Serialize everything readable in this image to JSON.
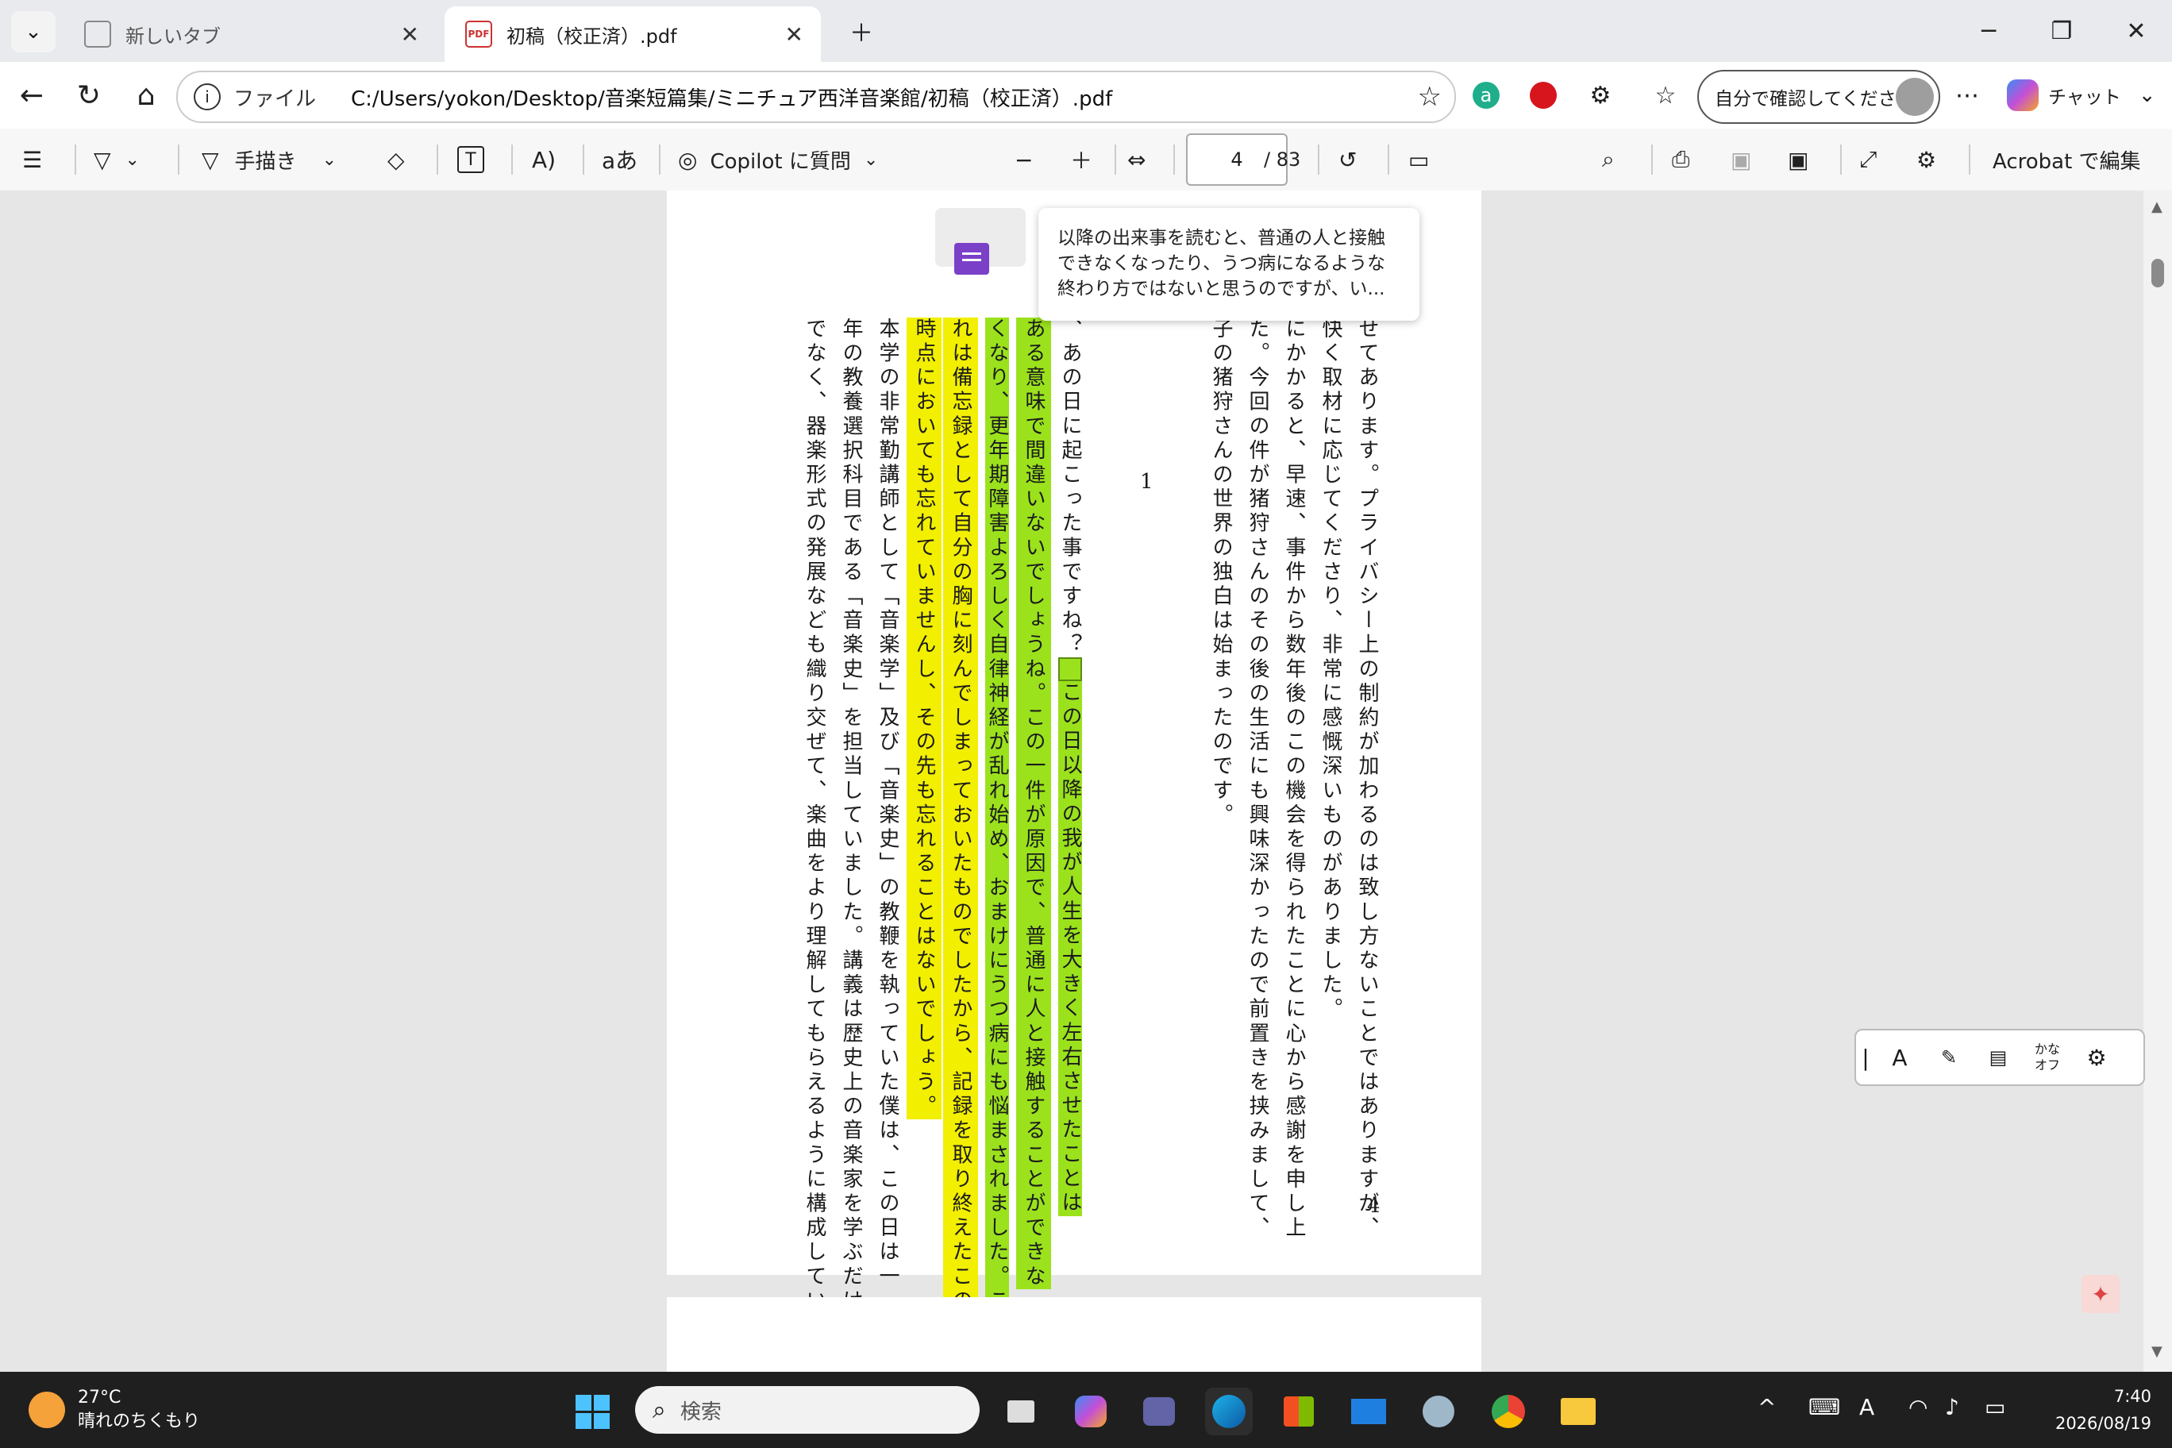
{
  "tabs": [
    {
      "label": "新しいタブ"
    },
    {
      "label": "初稿（校正済）.pdf"
    }
  ],
  "window": {
    "minimize": "─",
    "maximize": "❐",
    "close": "✕"
  },
  "address": {
    "scheme_label": "ファイル",
    "url": "C:/Users/yokon/Desktop/音楽短篇集/ミニチュア西洋音楽館/初稿（校正済）.pdf"
  },
  "profile": {
    "label": "自分で確認してください"
  },
  "chat": {
    "label": "チャット"
  },
  "toolbar": {
    "draw_label": "手描き",
    "copilot_label": "Copilot に質問",
    "page_current": "4",
    "page_total": "/ 83",
    "edit_label": "Acrobat で編集"
  },
  "document": {
    "col1": "せてあります。プライバシー上の制約が加わるのは致し方ないことではありますが、",
    "col2": "快く取材に応じてくださり、非常に感慨深いものがありました。",
    "col3": "にかかると、早速、事件から数年後のこの機会を得られたことに心から感謝を申し上",
    "col4": "た。今回の件が猪狩さんのその後の生活にも興味深かったので前置きを挟みまして、",
    "col5": "子の猪狩さんの世界の独白は始まったのです。",
    "page_mark": "1",
    "col6a": "、あの日に起こった事ですね？",
    "col6b": "この日以降の我が人生を大きく左右させたことは",
    "col7": "ある意味で間違いないでしょうね。この一件が原因で、普通に人と接触することができな",
    "col8": "くなり、更年期障害よろしく自律神経が乱れ始め、おまけにうつ病にも悩まされました。こ",
    "col9": "れは備忘録として自分の胸に刻んでしまっておいたものでしたから、記録を取り終えたこの",
    "col10": "時点においても忘れていませんし、その先も忘れることはないでしょう。",
    "col11": "本学の非常勤講師として「音楽学」及び「音楽史」の教鞭を執っていた僕は、この日は一",
    "col12": "年の教養選択科目である「音楽史」を担当していました。講義は歴史上の音楽家を学ぶだけ",
    "col13": "でなく、器楽形式の発展なども織り交ぜて、楽曲をより理解してもらえるように構成してい",
    "page_number": "4"
  },
  "comment": {
    "text": "以降の出来事を読むと、普通の人と接触できなくなったり、うつ病になるような終わり方ではないと思うのですが、い..."
  },
  "ime": {
    "kana": "かな",
    "kana_state": "オフ"
  },
  "taskbar": {
    "temp": "27°C",
    "weather": "晴れのちくもり",
    "search_placeholder": "検索",
    "time": "7:40",
    "date": "2026/08/19"
  },
  "colors": {
    "highlight_green": "#9be21d",
    "highlight_yellow": "#f2ef00",
    "comment_purple": "#7a40c8"
  }
}
